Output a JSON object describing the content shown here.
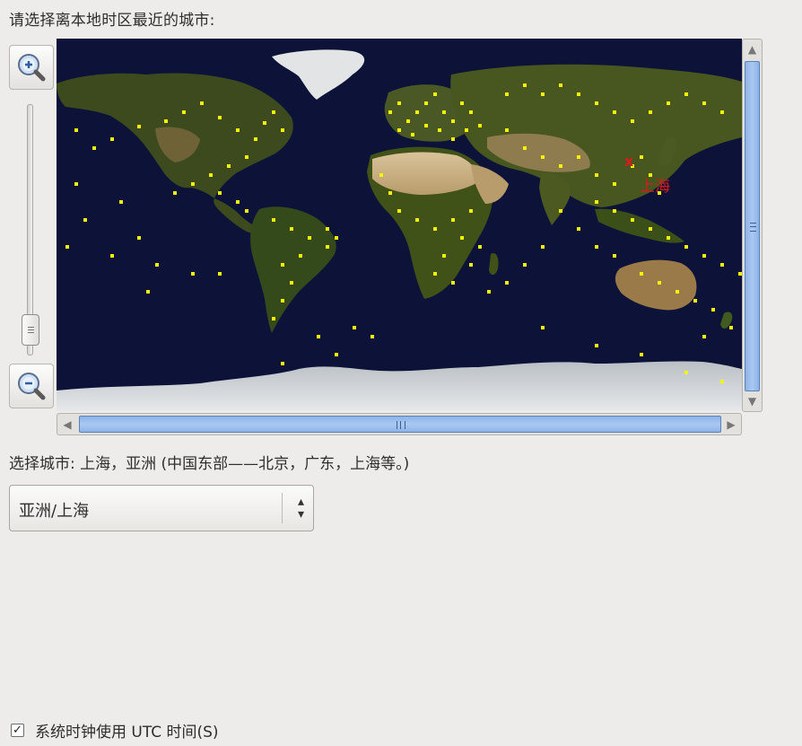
{
  "prompt": "请选择离本地时区最近的城市:",
  "zoom": {
    "in_icon": "zoom-in-icon",
    "out_icon": "zoom-out-icon",
    "slider_level": 0.85
  },
  "map": {
    "selected_city_label": "上海",
    "marker_icon": "x-marker-icon",
    "city_dot_color": "#f5f500",
    "marker_color": "#d81b1b",
    "ocean_color": "#0c1238"
  },
  "selected_city_text": "选择城市: 上海，亚洲 (中国东部——北京，广东，上海等。)",
  "timezone_combo": {
    "value": "亚洲/上海",
    "icon": "updown-chevron-icon"
  },
  "utc_checkbox": {
    "label": "系统时钟使用 UTC 时间(S)",
    "checked": true,
    "check_glyph": "✓"
  },
  "colors": {
    "background": "#edeceb",
    "scroll_thumb": "#a9c9f2"
  }
}
